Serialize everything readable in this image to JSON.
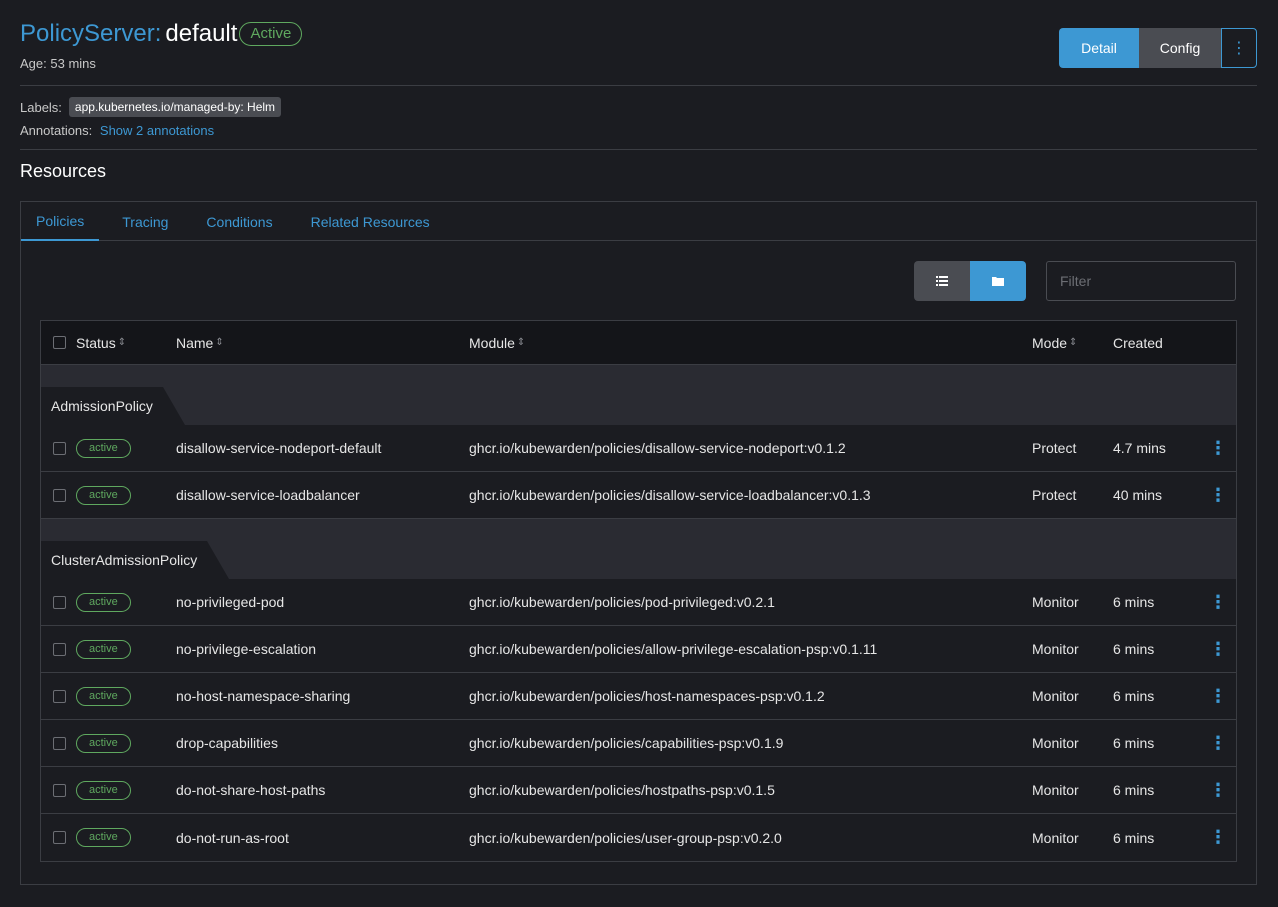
{
  "header": {
    "kind": "PolicyServer:",
    "name": "default",
    "state": "Active",
    "age_label": "Age:",
    "age_value": "53 mins",
    "detail_label": "Detail",
    "config_label": "Config",
    "more_label": "⋮"
  },
  "meta": {
    "labels_label": "Labels:",
    "label_chip": "app.kubernetes.io/managed-by: Helm",
    "annotations_label": "Annotations:",
    "annotations_link": "Show 2 annotations"
  },
  "resources_title": "Resources",
  "tabs": [
    {
      "label": "Policies",
      "active": true
    },
    {
      "label": "Tracing",
      "active": false
    },
    {
      "label": "Conditions",
      "active": false
    },
    {
      "label": "Related Resources",
      "active": false
    }
  ],
  "filter_placeholder": "Filter",
  "columns": {
    "status": "Status",
    "name": "Name",
    "module": "Module",
    "mode": "Mode",
    "created": "Created"
  },
  "groups": [
    {
      "name": "AdmissionPolicy",
      "rows": [
        {
          "status": "active",
          "name": "disallow-service-nodeport-default",
          "module": "ghcr.io/kubewarden/policies/disallow-service-nodeport:v0.1.2",
          "mode": "Protect",
          "created": "4.7 mins"
        },
        {
          "status": "active",
          "name": "disallow-service-loadbalancer",
          "module": "ghcr.io/kubewarden/policies/disallow-service-loadbalancer:v0.1.3",
          "mode": "Protect",
          "created": "40 mins"
        }
      ]
    },
    {
      "name": "ClusterAdmissionPolicy",
      "rows": [
        {
          "status": "active",
          "name": "no-privileged-pod",
          "module": "ghcr.io/kubewarden/policies/pod-privileged:v0.2.1",
          "mode": "Monitor",
          "created": "6 mins"
        },
        {
          "status": "active",
          "name": "no-privilege-escalation",
          "module": "ghcr.io/kubewarden/policies/allow-privilege-escalation-psp:v0.1.11",
          "mode": "Monitor",
          "created": "6 mins"
        },
        {
          "status": "active",
          "name": "no-host-namespace-sharing",
          "module": "ghcr.io/kubewarden/policies/host-namespaces-psp:v0.1.2",
          "mode": "Monitor",
          "created": "6 mins"
        },
        {
          "status": "active",
          "name": "drop-capabilities",
          "module": "ghcr.io/kubewarden/policies/capabilities-psp:v0.1.9",
          "mode": "Monitor",
          "created": "6 mins"
        },
        {
          "status": "active",
          "name": "do-not-share-host-paths",
          "module": "ghcr.io/kubewarden/policies/hostpaths-psp:v0.1.5",
          "mode": "Monitor",
          "created": "6 mins"
        },
        {
          "status": "active",
          "name": "do-not-run-as-root",
          "module": "ghcr.io/kubewarden/policies/user-group-psp:v0.2.0",
          "mode": "Monitor",
          "created": "6 mins"
        }
      ]
    }
  ],
  "colors": {
    "accent": "#3d98d3",
    "active_green": "#5fa85f",
    "background": "#1b1c21"
  },
  "icons": {
    "list_view": "list-icon",
    "folder_view": "folder-icon",
    "row_actions": "kebab-icon"
  }
}
